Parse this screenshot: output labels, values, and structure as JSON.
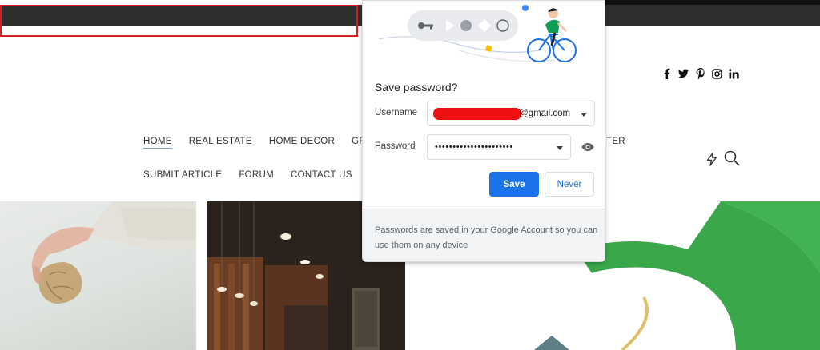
{
  "nav": {
    "row1": [
      "HOME",
      "REAL ESTATE",
      "HOME DECOR",
      "GROUP"
    ],
    "row1_tail": "TER",
    "row2": [
      "SUBMIT ARTICLE",
      "FORUM",
      "CONTACT US"
    ]
  },
  "social_icons": [
    "facebook-icon",
    "twitter-icon",
    "pinterest-icon",
    "instagram-icon",
    "linkedin-icon"
  ],
  "header_icons": [
    "bolt-icon",
    "search-icon"
  ],
  "password_popup": {
    "title": "Save password?",
    "username_label": "Username",
    "username_value_visible": "@gmail.com",
    "password_label": "Password",
    "password_value": "••••••••••••••••••••••",
    "save_label": "Save",
    "never_label": "Never",
    "footer_text": "Passwords are saved in your Google Account so you can use them on any device"
  },
  "colors": {
    "top_bar": "#2f2f2f",
    "highlight": "#d61f1f",
    "save_button": "#1a73e8",
    "redaction": "#ee1111",
    "green_graphic": "#3aa84a"
  }
}
